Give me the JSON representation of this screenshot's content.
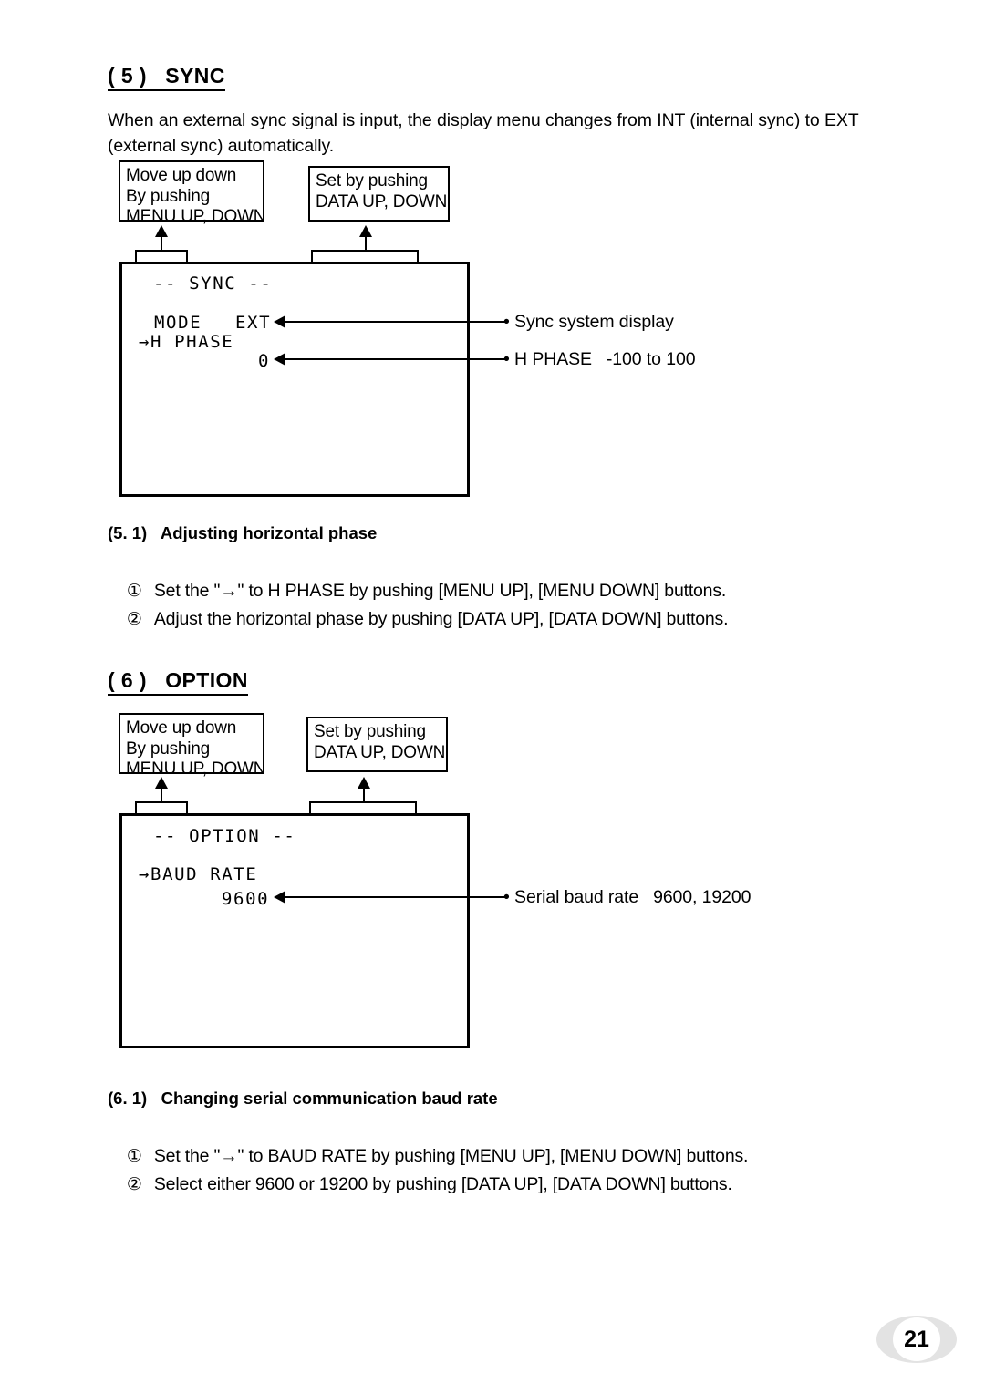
{
  "page": {
    "number": "21"
  },
  "section_sync": {
    "heading": "( 5 )   SYNC",
    "intro": "When an external sync signal is input, the display menu changes from INT (internal sync) to EXT (external sync) automatically.",
    "callout_menu": "Move up down\nBy pushing\nMENU UP, DOWN",
    "callout_data": "Set by pushing\nDATA UP, DOWN",
    "osd": {
      "title": "-- SYNC --",
      "line_mode_label": "MODE",
      "line_mode_value": "EXT",
      "line_phase_label": "→H PHASE",
      "line_phase_value": "0"
    },
    "annotations": [
      "• Sync system display",
      "• H PHASE   -100 to 100"
    ],
    "sub_heading": "(5. 1)   Adjusting horizontal phase",
    "steps": [
      {
        "num": "①",
        "text": "Set the \"→\" to H PHASE by pushing [MENU UP], [MENU DOWN] buttons."
      },
      {
        "num": "②",
        "text": "Adjust the horizontal phase by pushing [DATA UP], [DATA DOWN] buttons."
      }
    ]
  },
  "section_option": {
    "heading": "( 6 )   OPTION",
    "callout_menu": "Move up down\nBy pushing\nMENU UP, DOWN",
    "callout_data": "Set by pushing\nDATA UP, DOWN",
    "osd": {
      "title": "-- OPTION --",
      "line_baud_label": "→BAUD RATE",
      "line_baud_value": "9600"
    },
    "annotations": [
      "• Serial baud rate   9600, 19200"
    ],
    "sub_heading": "(6. 1)   Changing serial communication baud rate",
    "steps": [
      {
        "num": "①",
        "text": "Set the \"→\" to BAUD RATE by pushing [MENU UP], [MENU DOWN] buttons."
      },
      {
        "num": "②",
        "text": "Select either 9600 or 19200 by pushing [DATA UP], [DATA DOWN] buttons."
      }
    ]
  }
}
